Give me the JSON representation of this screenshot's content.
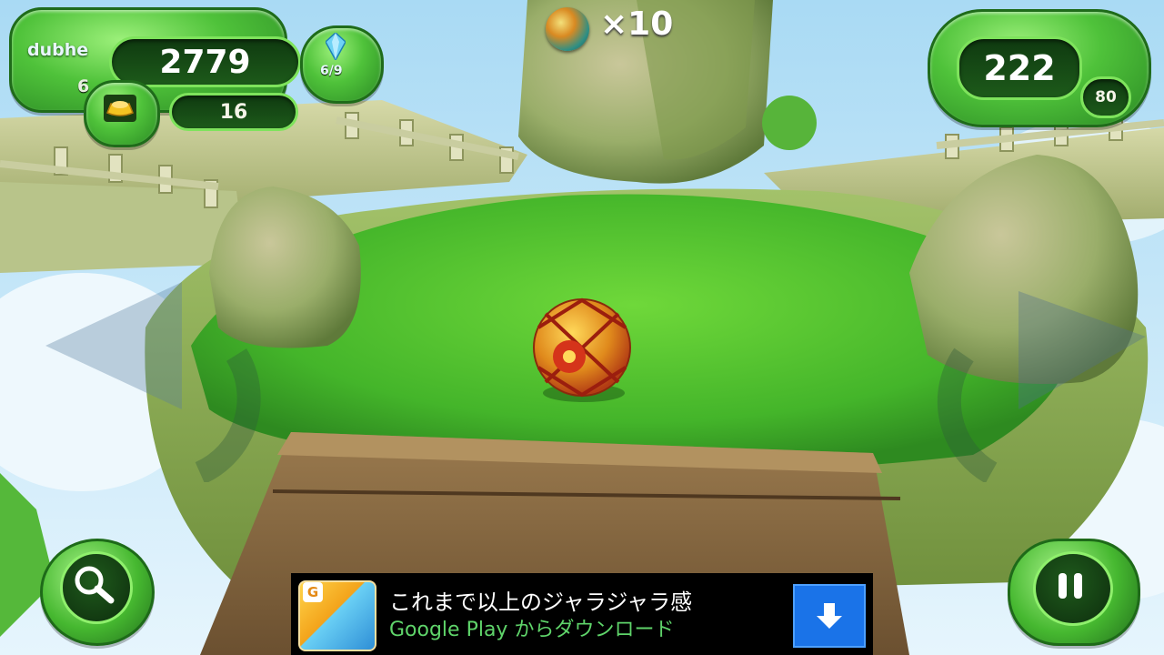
{
  "hud": {
    "player_name": "dubhe",
    "player_level": "6",
    "score": "2779",
    "gems": "6/9",
    "coins": "16",
    "balls_remaining": "×10",
    "timer": "222",
    "bonus": "80"
  },
  "icons": {
    "gem": "crystal-gem-icon",
    "gold": "gold-ingot-icon",
    "ball": "temari-ball-icon",
    "search": "magnifier-icon",
    "pause": "pause-icon",
    "download": "download-arrow-icon"
  },
  "ad": {
    "title": "これまで以上のジャラジャラ感",
    "subtitle": "Google Play からダウンロード",
    "app_badge": "G"
  },
  "colors": {
    "jade": "#4fc23a",
    "dark_green": "#1d5a1a",
    "ad_button": "#1a73e8",
    "ad_subtitle": "#5fd46a"
  }
}
